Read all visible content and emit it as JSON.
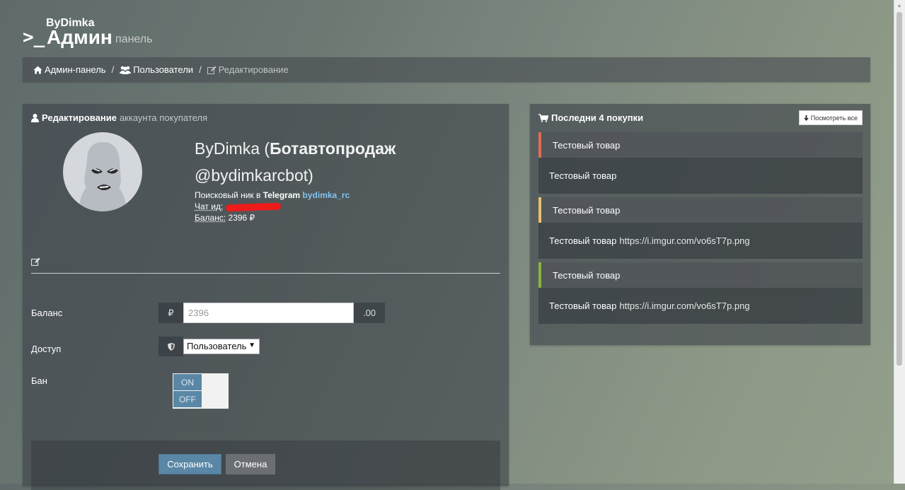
{
  "header": {
    "brand": "ByDimka",
    "prompt": ">_",
    "title": "Админ",
    "subtitle": "панель"
  },
  "breadcrumb": [
    {
      "label": "Админ-панель",
      "icon": "home-icon"
    },
    {
      "label": "Пользователи",
      "icon": "users-icon"
    },
    {
      "label": "Редактирование",
      "icon": "edit-icon"
    }
  ],
  "breadcrumb_sep": "/",
  "user_panel": {
    "heading_bold": "Редактирование",
    "heading_muted": "аккаунта покупателя",
    "name_prefix": "ByDimka (",
    "name_bold": "Ботавтопродаж",
    "username": "@bydimkarcbot)",
    "telegram_label": "Поисковый ник в",
    "telegram_word": "Telegram",
    "telegram_nick": "bydimka_rc",
    "chat_id_label": "Чат ид:",
    "balance_label": "Баланс:",
    "balance_value": "2396 ₽"
  },
  "form": {
    "balance_label": "Баланс",
    "currency": "₽",
    "balance_input": "2396",
    "balance_suffix": ".00",
    "access_label": "Доступ",
    "access_selected": "Пользователь",
    "ban_label": "Бан",
    "toggle_on": "ON",
    "toggle_off": "OFF",
    "save_label": "Сохранить",
    "cancel_label": "Отмена"
  },
  "purchases_panel": {
    "heading": "Последни 4 покупки",
    "view_all": "Посмотреть все",
    "items": [
      {
        "title": "Тестовый товар",
        "body_name": "Тестовый товар",
        "url": "",
        "accent": "#e06c54"
      },
      {
        "title": "Тестовый товар",
        "body_name": "Тестовый товар",
        "url": "https://i.imgur.com/vo6sT7p.png",
        "accent": "#e8c070"
      },
      {
        "title": "Тестовый товар",
        "body_name": "Тестовый товар",
        "url": "https://i.imgur.com/vo6sT7p.png",
        "accent": "#8bb43c"
      }
    ]
  },
  "colors": {
    "primary_button": "#5a87a6",
    "link": "#7fc4ee"
  }
}
